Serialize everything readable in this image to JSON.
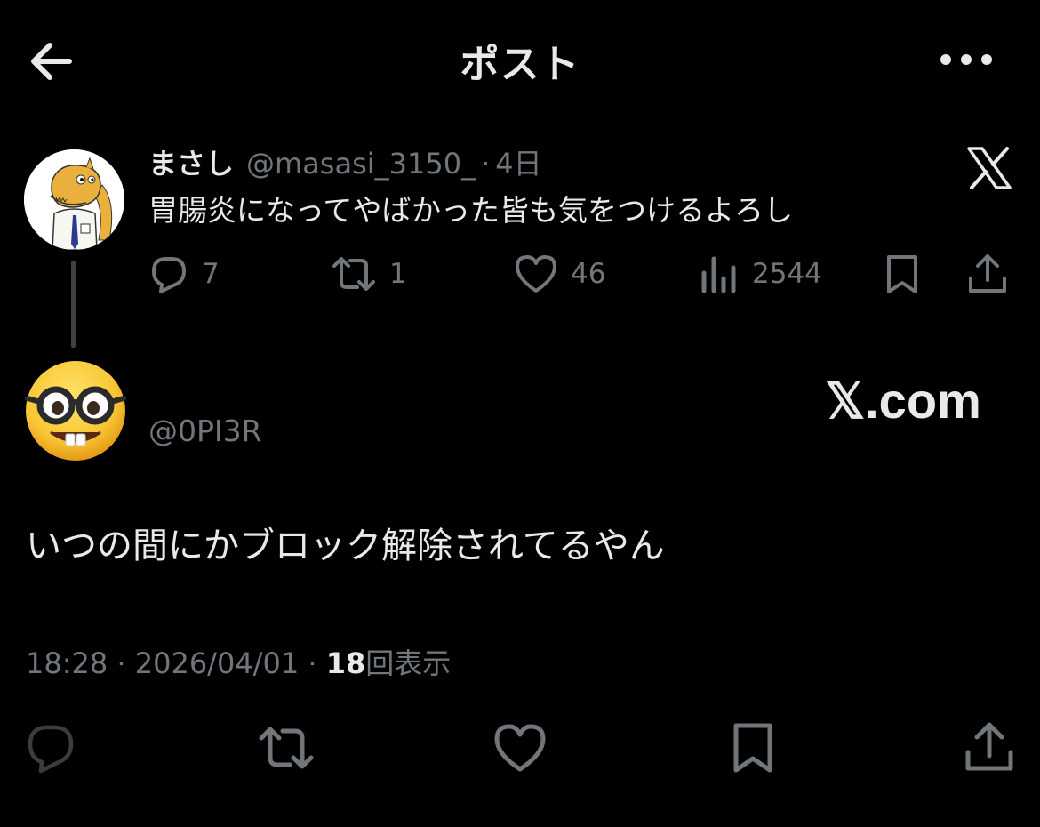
{
  "header": {
    "title": "ポスト",
    "back_icon": "arrow-left-icon",
    "more_icon": "more-horizontal-icon"
  },
  "parent_post": {
    "display_name": "まさし",
    "handle": "@masasi_3150_",
    "separator": "·",
    "time": "4日",
    "text": "胃腸炎になってやばかった皆も気をつけるよろし",
    "brand_icon": "x-logo-icon",
    "actions": {
      "replies": "7",
      "reposts": "1",
      "likes": "46",
      "views": "2544"
    }
  },
  "main_post": {
    "handle": "@0PI3R",
    "watermark": "𝕏.com",
    "text": "いつの間にかブロック解除されてるやん",
    "time": "18:28",
    "sep1": "·",
    "date": "2026/04/01",
    "sep2": "·",
    "views_count": "18",
    "views_label": "回表示"
  },
  "colors": {
    "background": "#000000",
    "primary_text": "#e7e9ea",
    "secondary_text": "#71767b",
    "thread_line": "#3e4144"
  }
}
